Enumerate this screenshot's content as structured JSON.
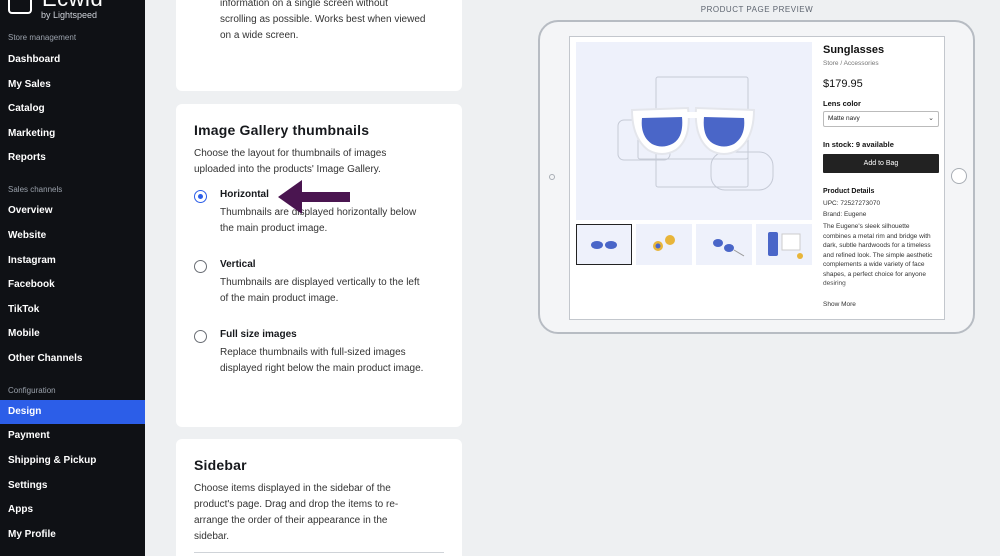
{
  "brand": {
    "name": "Ecwid",
    "sub": "by Lightspeed"
  },
  "sidebar": {
    "sections": [
      {
        "label": "Store management",
        "items": [
          "Dashboard",
          "My Sales",
          "Catalog",
          "Marketing",
          "Reports"
        ]
      },
      {
        "label": "Sales channels",
        "items": [
          "Overview",
          "Website",
          "Instagram",
          "Facebook",
          "TikTok",
          "Mobile",
          "Other Channels"
        ]
      },
      {
        "label": "Configuration",
        "items": [
          "Design",
          "Payment",
          "Shipping & Pickup",
          "Settings",
          "Apps",
          "My Profile"
        ]
      }
    ],
    "active": "Design"
  },
  "top_card": {
    "lines": [
      "information on a single screen without",
      "scrolling as possible. Works best when viewed",
      "on a wide screen."
    ]
  },
  "gallery_card": {
    "title": "Image Gallery thumbnails",
    "description": [
      "Choose the layout for thumbnails of images",
      "uploaded into the products' Image Gallery."
    ],
    "options": [
      {
        "label": "Horizontal",
        "desc": [
          "Thumbnails are displayed horizontally below",
          "the main product image."
        ],
        "checked": true
      },
      {
        "label": "Vertical",
        "desc": [
          "Thumbnails are displayed vertically to the left",
          "of the main product image."
        ],
        "checked": false
      },
      {
        "label": "Full size images",
        "desc": [
          "Replace thumbnails with full-sized images",
          "displayed right below the main product image."
        ],
        "checked": false
      }
    ]
  },
  "sidebar_card": {
    "title": "Sidebar",
    "description": [
      "Choose items displayed in the sidebar of the",
      "product's page. Drag and drop the items to re-",
      "arrange the order of their appearance in the",
      "sidebar."
    ]
  },
  "preview": {
    "label": "PRODUCT PAGE PREVIEW",
    "product": {
      "title": "Sunglasses",
      "breadcrumb": "Store  /  Accessories",
      "price": "$179.95",
      "lens_label": "Lens color",
      "lens_value": "Matte navy",
      "stock": "In stock: 9 available",
      "add_button": "Add to Bag",
      "details_heading": "Product Details",
      "upc": "UPC: 72527273070",
      "brand": "Brand: Eugene",
      "description": "The Eugene's sleek silhouette combines a metal rim and bridge with dark, subtle hardwoods for a timeless and refined look. The simple aesthetic complements a wide variety of face shapes, a perfect choice for anyone desiring",
      "show_more": "Show More"
    }
  },
  "colors": {
    "accent": "#2c5ee8",
    "sidebar_bg": "#0f1115",
    "arrow": "#4a1550",
    "lens": "#4a66c8"
  }
}
